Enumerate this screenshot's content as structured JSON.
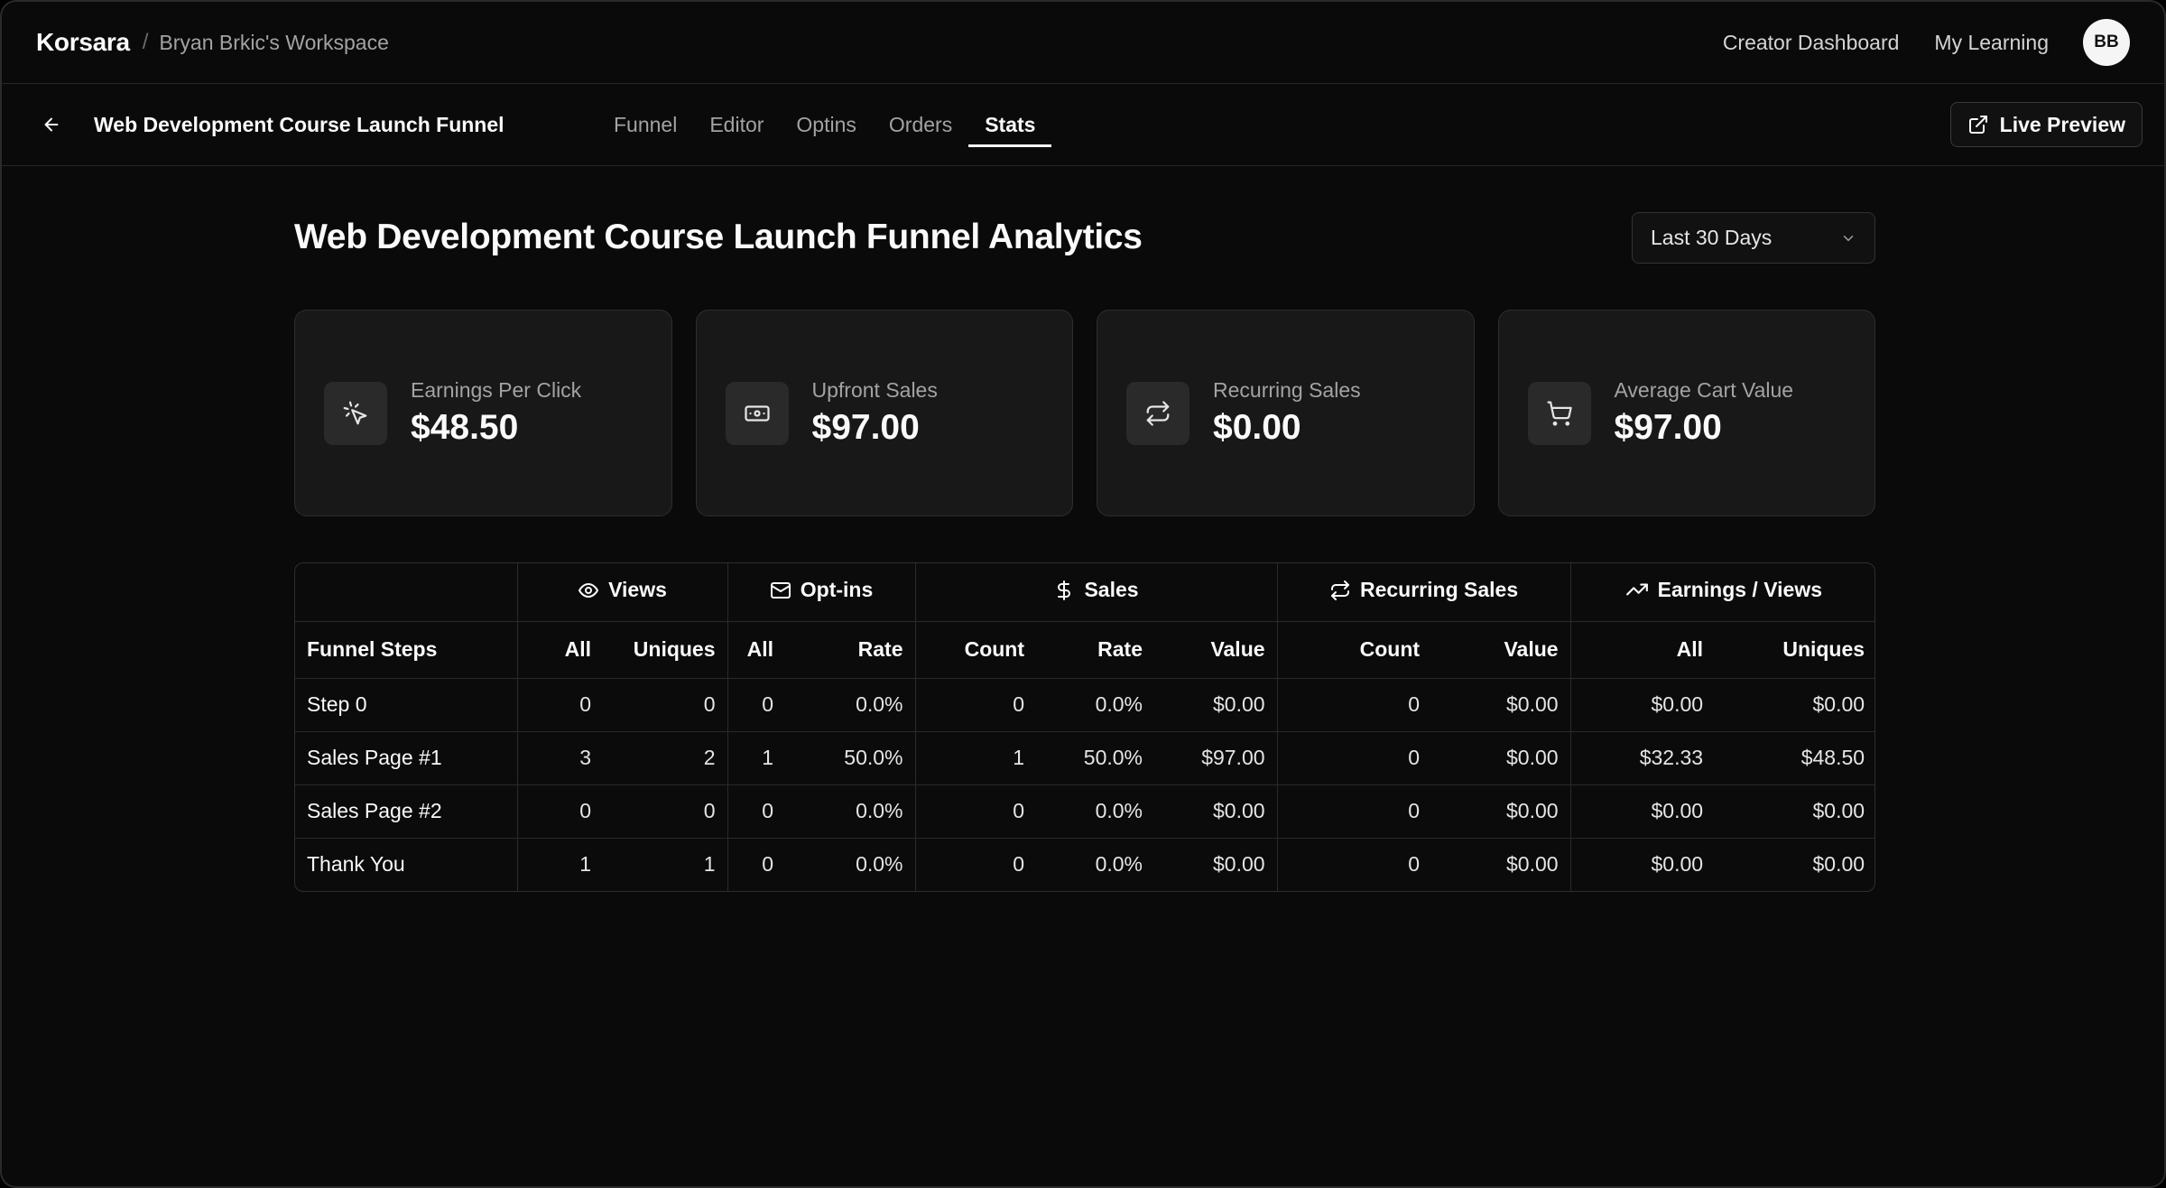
{
  "header": {
    "brand": "Korsara",
    "separator": "/",
    "workspace": "Bryan Brkic's Workspace",
    "links": [
      "Creator Dashboard",
      "My Learning"
    ],
    "avatar_initials": "BB"
  },
  "subheader": {
    "funnel_name": "Web Development Course Launch Funnel",
    "tabs": [
      "Funnel",
      "Editor",
      "Optins",
      "Orders",
      "Stats"
    ],
    "active_tab": "Stats",
    "live_preview_label": "Live Preview"
  },
  "page": {
    "title": "Web Development Course Launch Funnel Analytics",
    "date_range": "Last 30 Days"
  },
  "cards": [
    {
      "label": "Earnings Per Click",
      "value": "$48.50",
      "icon": "pointer-click-icon"
    },
    {
      "label": "Upfront Sales",
      "value": "$97.00",
      "icon": "banknote-icon"
    },
    {
      "label": "Recurring Sales",
      "value": "$0.00",
      "icon": "repeat-icon"
    },
    {
      "label": "Average Cart Value",
      "value": "$97.00",
      "icon": "shopping-cart-icon"
    }
  ],
  "table": {
    "groups": [
      {
        "label": "Views",
        "icon": "eye-icon"
      },
      {
        "label": "Opt-ins",
        "icon": "mail-icon"
      },
      {
        "label": "Sales",
        "icon": "dollar-icon"
      },
      {
        "label": "Recurring Sales",
        "icon": "repeat-icon"
      },
      {
        "label": "Earnings / Views",
        "icon": "trending-up-icon"
      }
    ],
    "columns": [
      "Funnel Steps",
      "All",
      "Uniques",
      "All",
      "Rate",
      "Count",
      "Rate",
      "Value",
      "Count",
      "Value",
      "All",
      "Uniques"
    ],
    "rows": [
      [
        "Step 0",
        "0",
        "0",
        "0",
        "0.0%",
        "0",
        "0.0%",
        "$0.00",
        "0",
        "$0.00",
        "$0.00",
        "$0.00"
      ],
      [
        "Sales Page #1",
        "3",
        "2",
        "1",
        "50.0%",
        "1",
        "50.0%",
        "$97.00",
        "0",
        "$0.00",
        "$32.33",
        "$48.50"
      ],
      [
        "Sales Page #2",
        "0",
        "0",
        "0",
        "0.0%",
        "0",
        "0.0%",
        "$0.00",
        "0",
        "$0.00",
        "$0.00",
        "$0.00"
      ],
      [
        "Thank You",
        "1",
        "1",
        "0",
        "0.0%",
        "0",
        "0.0%",
        "$0.00",
        "0",
        "$0.00",
        "$0.00",
        "$0.00"
      ]
    ]
  },
  "colors": {
    "background": "#0a0a0a",
    "card": "#181818",
    "border": "#2e2e2e",
    "text": "#fafafa",
    "muted": "#a3a3a3"
  }
}
